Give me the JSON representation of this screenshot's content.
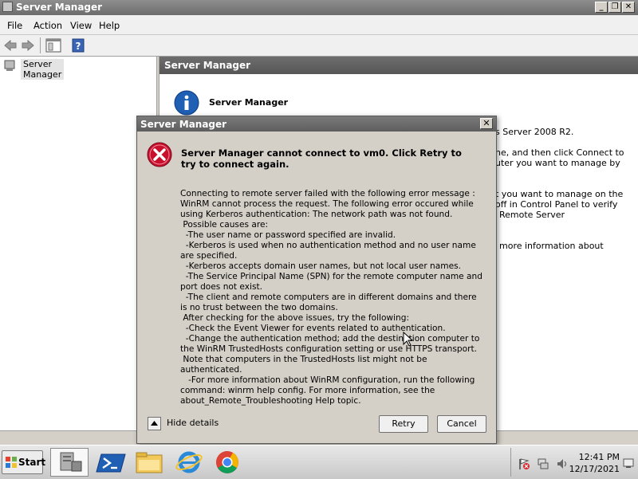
{
  "window": {
    "title": "Server Manager",
    "controls": {
      "minimize": "_",
      "restore": "❐",
      "close": "✕"
    }
  },
  "menubar": {
    "items": [
      "File",
      "Action",
      "View",
      "Help"
    ]
  },
  "toolbar": {
    "icons": [
      "back-icon",
      "forward-icon",
      "show-hide-console-tree-icon",
      "help-icon"
    ]
  },
  "tree": {
    "root_label": "Server Manager"
  },
  "right_pane": {
    "header": "Server Manager",
    "section_title": "Server Manager",
    "visible_fragments": [
      "s Server 2008 R2.",
      "ne, and then click Connect to",
      "uter you want to manage by",
      "t you want to manage on the",
      "off in Control Panel to verify",
      "Remote Server",
      "more information about"
    ]
  },
  "dialog": {
    "title": "Server Manager",
    "close_label": "✕",
    "heading": "Server Manager cannot connect to vm0. Click Retry to try to connect again.",
    "body": "Connecting to remote server failed with the following error message : WinRM cannot process the request. The following error occured while using Kerberos authentication: The network path was not found.\n Possible causes are:\n  -The user name or password specified are invalid.\n  -Kerberos is used when no authentication method and no user name are specified.\n  -Kerberos accepts domain user names, but not local user names.\n  -The Service Principal Name (SPN) for the remote computer name and port does not exist.\n  -The client and remote computers are in different domains and there is no trust between the two domains.\n After checking for the above issues, try the following:\n  -Check the Event Viewer for events related to authentication.\n  -Change the authentication method; add the destination computer to the WinRM TrustedHosts configuration setting or use HTTPS transport.\n Note that computers in the TrustedHosts list might not be authenticated.\n   -For more information about WinRM configuration, run the following command: winrm help config. For more information, see the about_Remote_Troubleshooting Help topic.",
    "hide_details_label": "Hide details",
    "retry_label": "Retry",
    "cancel_label": "Cancel"
  },
  "taskbar": {
    "start_label": "Start",
    "pinned": [
      "server-manager-icon",
      "powershell-icon",
      "file-explorer-icon",
      "internet-explorer-icon",
      "chrome-icon"
    ],
    "tray_icons": [
      "action-center-flag-icon",
      "network-icon",
      "volume-icon"
    ],
    "time": "12:41 PM",
    "date": "12/17/2021"
  },
  "colors": {
    "titlebar": "#6c6c6c",
    "error_icon": "#c8102e",
    "info_icon": "#1f5fb4",
    "dialog_bg": "#d4d0c8"
  }
}
